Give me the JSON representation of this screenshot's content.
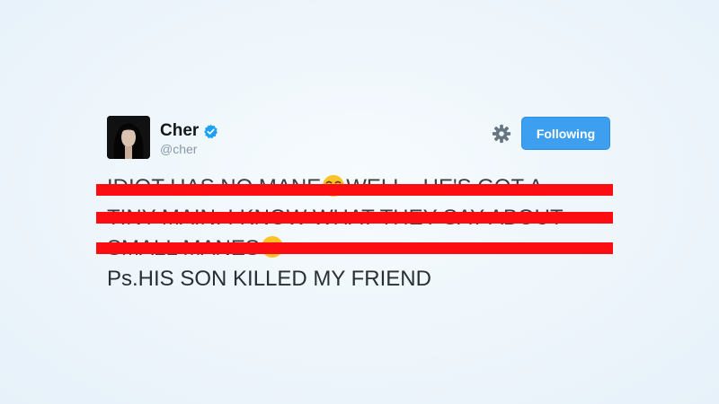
{
  "user": {
    "display_name": "Cher",
    "handle": "@cher",
    "verified": true
  },
  "actions": {
    "follow_label": "Following"
  },
  "icons": {
    "settings": "gear-icon",
    "verified": "verified-badge-icon",
    "emoji_1": "face-with-tears-of-joy-icon",
    "emoji_2": "face-with-tongue-icon"
  },
  "tweet": {
    "struck_lines": [
      "IDIOT HAS NO MANE",
      "WELL...HE'S GOT A",
      "TINY MAIN. I KNOW WHAT THEY SAY ABOUT",
      "SMALL MANES"
    ],
    "visible_line": "Ps.HIS SON KILLED MY FRIEND"
  },
  "colors": {
    "follow_button": "#3d9ff0",
    "redaction": "#fc0d12",
    "verified": "#1da1f2",
    "handle": "#8899a6",
    "text": "#292f33"
  }
}
